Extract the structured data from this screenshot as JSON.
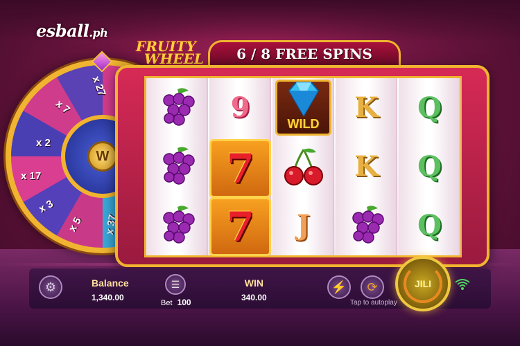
{
  "brand": {
    "name": "esball",
    "suffix": ".ph"
  },
  "game": {
    "title_line1": "FRUITY",
    "title_line2": "WHEEL",
    "free_spins": "6 / 8 FREE SPINS"
  },
  "wheel": {
    "center": "W",
    "segments": [
      "x 27",
      "x 7",
      "x 2",
      "x 17",
      "x 3",
      "x 5",
      "x 37"
    ]
  },
  "reels": [
    [
      "grapes",
      "grapes",
      "grapes"
    ],
    [
      "9",
      "7",
      "7"
    ],
    [
      "wild",
      "cherries",
      "J"
    ],
    [
      "K",
      "K",
      "grapes"
    ],
    [
      "Q",
      "Q",
      "Q"
    ]
  ],
  "wild_label": "WILD",
  "symbols": {
    "nine": "9",
    "seven": "7",
    "jack": "J",
    "king": "K",
    "queen": "Q"
  },
  "bottom": {
    "balance_label": "Balance",
    "balance_value": "1,340.00",
    "bet_label": "Bet",
    "bet_value": "100",
    "win_label": "WIN",
    "win_value": "340.00",
    "autoplay_hint": "Tap to autoplay",
    "spin_label": "JILI"
  },
  "colors": {
    "accent_gold": "#f0b430",
    "frame_red": "#d62a55"
  },
  "icons": [
    "gear-icon",
    "coin-stack-icon",
    "lightning-icon",
    "autoplay-icon",
    "wifi-icon"
  ]
}
